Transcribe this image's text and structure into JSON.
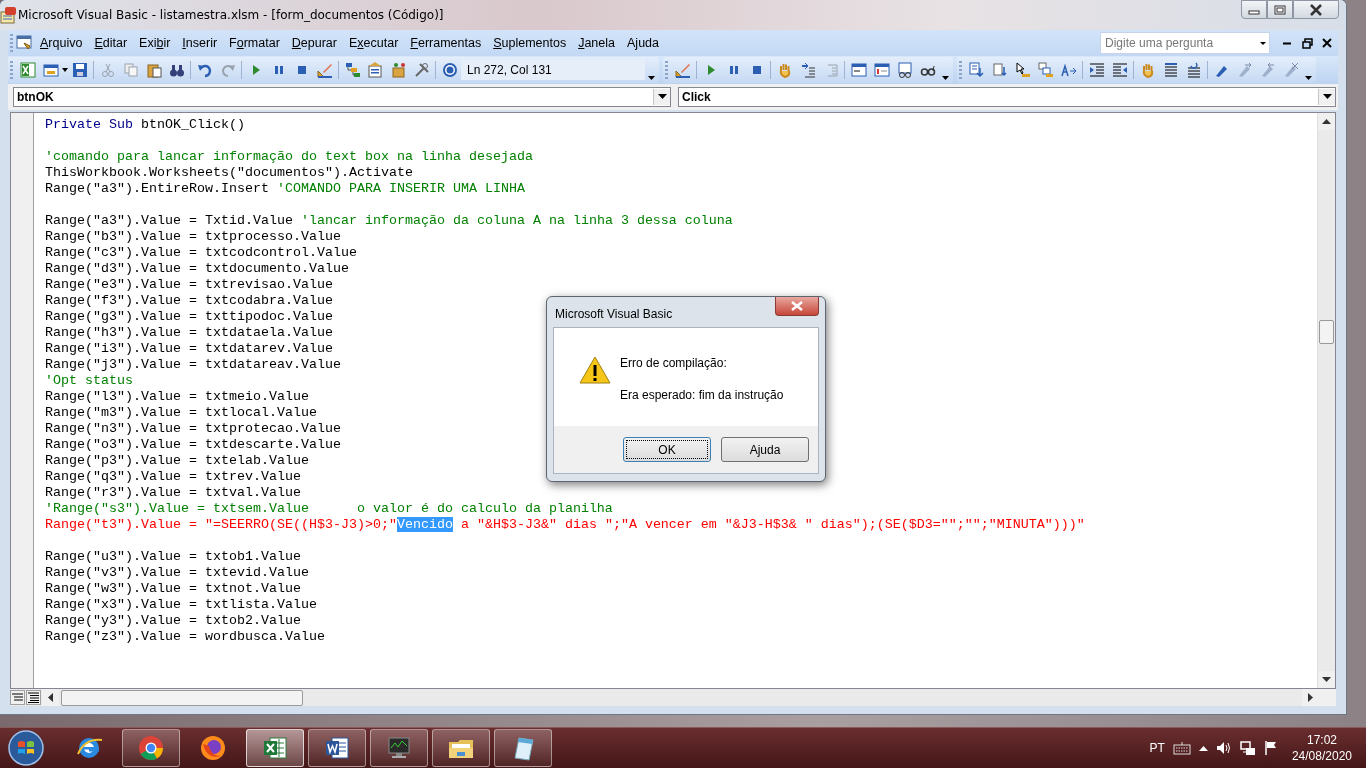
{
  "window": {
    "title": "Microsoft Visual Basic - listamestra.xlsm - [form_documentos (Código)]"
  },
  "menu": [
    {
      "key": "A",
      "post": "rquivo"
    },
    {
      "key": "E",
      "post": "ditar"
    },
    {
      "pre": "Exi",
      "key": "b",
      "post": "ir"
    },
    {
      "key": "I",
      "post": "nserir"
    },
    {
      "pre": "F",
      "key": "o",
      "post": "rmatar"
    },
    {
      "key": "D",
      "post": "epurar"
    },
    {
      "pre": "E",
      "key": "x",
      "post": "ecutar"
    },
    {
      "key": "F",
      "post": "erramentas"
    },
    {
      "key": "S",
      "post": "uplementos"
    },
    {
      "key": "J",
      "post": "anela"
    },
    {
      "pre": "A",
      "key": "j",
      "post": "uda"
    }
  ],
  "help_box": {
    "placeholder": "Digite uma pergunta"
  },
  "toolbar": {
    "position": "Ln 272, Col 131"
  },
  "object_combo": {
    "value": "btnOK"
  },
  "procedure_combo": {
    "value": "Click"
  },
  "code_lines": [
    {
      "kind": "code",
      "segments": [
        {
          "kind": "keyword",
          "text": "Private Sub"
        },
        {
          "kind": "plain",
          "text": " btnOK_Click()"
        }
      ]
    },
    {
      "kind": "blank"
    },
    {
      "kind": "code",
      "segments": [
        {
          "kind": "comment",
          "text": "'comando para lancar informação do text box na linha desejada"
        }
      ]
    },
    {
      "kind": "code",
      "segments": [
        {
          "kind": "plain",
          "text": "ThisWorkbook.Worksheets(\"documentos\").Activate"
        }
      ]
    },
    {
      "kind": "code",
      "segments": [
        {
          "kind": "plain",
          "text": "Range(\"a3\").EntireRow.Insert "
        },
        {
          "kind": "comment",
          "text": "'COMANDO PARA INSERIR UMA LINHA"
        }
      ]
    },
    {
      "kind": "blank"
    },
    {
      "kind": "code",
      "segments": [
        {
          "kind": "plain",
          "text": "Range(\"a3\").Value = Txtid.Value "
        },
        {
          "kind": "comment",
          "text": "'lancar informação da coluna A na linha 3 dessa coluna"
        }
      ]
    },
    {
      "kind": "code",
      "segments": [
        {
          "kind": "plain",
          "text": "Range(\"b3\").Value = txtprocesso.Value"
        }
      ]
    },
    {
      "kind": "code",
      "segments": [
        {
          "kind": "plain",
          "text": "Range(\"c3\").Value = txtcodcontrol.Value"
        }
      ]
    },
    {
      "kind": "code",
      "segments": [
        {
          "kind": "plain",
          "text": "Range(\"d3\").Value = txtdocumento.Value"
        }
      ]
    },
    {
      "kind": "code",
      "segments": [
        {
          "kind": "plain",
          "text": "Range(\"e3\").Value = txtrevisao.Value"
        }
      ]
    },
    {
      "kind": "code",
      "segments": [
        {
          "kind": "plain",
          "text": "Range(\"f3\").Value = txtcodabra.Value"
        }
      ]
    },
    {
      "kind": "code",
      "segments": [
        {
          "kind": "plain",
          "text": "Range(\"g3\").Value = txttipodoc.Value"
        }
      ]
    },
    {
      "kind": "code",
      "segments": [
        {
          "kind": "plain",
          "text": "Range(\"h3\").Value = txtdataela.Value"
        }
      ]
    },
    {
      "kind": "code",
      "segments": [
        {
          "kind": "plain",
          "text": "Range(\"i3\").Value = txtdatarev.Value"
        }
      ]
    },
    {
      "kind": "code",
      "segments": [
        {
          "kind": "plain",
          "text": "Range(\"j3\").Value = txtdatareav.Value"
        }
      ]
    },
    {
      "kind": "code",
      "segments": [
        {
          "kind": "comment",
          "text": "'Opt status"
        }
      ]
    },
    {
      "kind": "code",
      "segments": [
        {
          "kind": "plain",
          "text": "Range(\"l3\").Value = txtmeio.Value"
        }
      ]
    },
    {
      "kind": "code",
      "segments": [
        {
          "kind": "plain",
          "text": "Range(\"m3\").Value = txtlocal.Value"
        }
      ]
    },
    {
      "kind": "code",
      "segments": [
        {
          "kind": "plain",
          "text": "Range(\"n3\").Value = txtprotecao.Value"
        }
      ]
    },
    {
      "kind": "code",
      "segments": [
        {
          "kind": "plain",
          "text": "Range(\"o3\").Value = txtdescarte.Value"
        }
      ]
    },
    {
      "kind": "code",
      "segments": [
        {
          "kind": "plain",
          "text": "Range(\"p3\").Value = txtelab.Value"
        }
      ]
    },
    {
      "kind": "code",
      "segments": [
        {
          "kind": "plain",
          "text": "Range(\"q3\").Value = txtrev.Value"
        }
      ]
    },
    {
      "kind": "code",
      "segments": [
        {
          "kind": "plain",
          "text": "Range(\"r3\").Value = txtval.Value"
        }
      ]
    },
    {
      "kind": "code",
      "segments": [
        {
          "kind": "comment",
          "text": "'Range(\"s3\").Value = txtsem.Value      o valor é do calculo da planilha"
        }
      ]
    },
    {
      "kind": "code",
      "segments": [
        {
          "kind": "error",
          "text": "Range(\"t3\").Value = \"=SEERRO(SE((H$3-J3)>0;\"",
          "selected": false
        },
        {
          "kind": "error",
          "text": "Vencido",
          "selected": true
        },
        {
          "kind": "error",
          "text": " a \"&H$3-J3&\" dias \";\"A vencer em \"&J3-H$3& \" dias\");(SE($D3=\"\";\"\";\"MINUTA\")))\"",
          "selected": false
        }
      ]
    },
    {
      "kind": "blank"
    },
    {
      "kind": "code",
      "segments": [
        {
          "kind": "plain",
          "text": "Range(\"u3\").Value = txtob1.Value"
        }
      ]
    },
    {
      "kind": "code",
      "segments": [
        {
          "kind": "plain",
          "text": "Range(\"v3\").Value = txtevid.Value"
        }
      ]
    },
    {
      "kind": "code",
      "segments": [
        {
          "kind": "plain",
          "text": "Range(\"w3\").Value = txtnot.Value"
        }
      ]
    },
    {
      "kind": "code",
      "segments": [
        {
          "kind": "plain",
          "text": "Range(\"x3\").Value = txtlista.Value"
        }
      ]
    },
    {
      "kind": "code",
      "segments": [
        {
          "kind": "plain",
          "text": "Range(\"y3\").Value = txtob2.Value"
        }
      ]
    },
    {
      "kind": "code",
      "segments": [
        {
          "kind": "plain",
          "text": "Range(\"z3\").Value = wordbusca.Value"
        }
      ]
    }
  ],
  "dialog": {
    "title": "Microsoft Visual Basic",
    "heading": "Erro de compilação:",
    "message": "Era esperado: fim da instrução",
    "buttons": [
      {
        "label": "OK",
        "focused": true
      },
      {
        "label": "Ajuda",
        "focused": false
      }
    ]
  },
  "taskbar": {
    "apps": [
      {
        "kind": "browser-e",
        "running": false,
        "active": false
      },
      {
        "kind": "chrome",
        "running": true,
        "active": false
      },
      {
        "kind": "firefox",
        "running": false,
        "active": false
      },
      {
        "kind": "spreadsheet",
        "running": true,
        "active": true
      },
      {
        "kind": "document",
        "running": true,
        "active": false
      },
      {
        "kind": "monitor",
        "running": true,
        "active": false
      },
      {
        "kind": "folder",
        "running": true,
        "active": false
      },
      {
        "kind": "notepad",
        "running": true,
        "active": false
      }
    ],
    "language": "PT",
    "time": "17:02",
    "date": "24/08/2020"
  }
}
